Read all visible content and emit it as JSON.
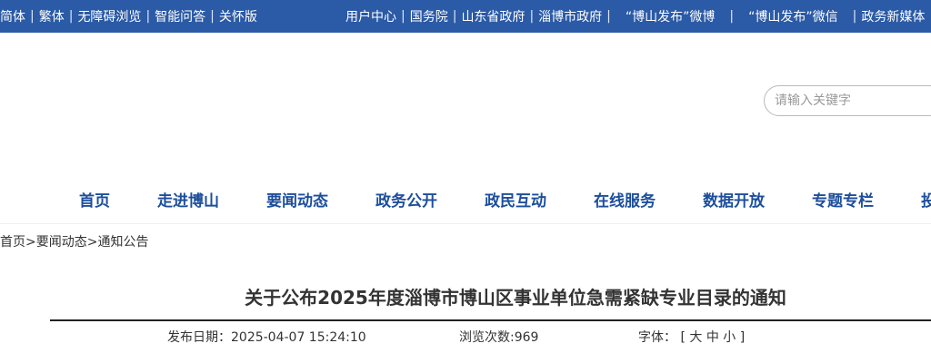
{
  "topbar": {
    "left": [
      "简体",
      "繁体",
      "无障碍浏览",
      "智能问答",
      "关怀版"
    ],
    "right": [
      "用户中心",
      "国务院",
      "山东省政府",
      "淄博市政府",
      "“博山发布”微博",
      "“博山发布”微信",
      "政务新媒体"
    ]
  },
  "search": {
    "placeholder": "请输入关键字"
  },
  "nav": [
    "首页",
    "走进博山",
    "要闻动态",
    "政务公开",
    "政民互动",
    "在线服务",
    "数据开放",
    "专题专栏",
    "投"
  ],
  "breadcrumb": {
    "items": [
      "首页",
      "要闻动态",
      "通知公告"
    ],
    "sep": ">"
  },
  "article": {
    "title": "关于公布2025年度淄博市博山区事业单位急需紧缺专业目录的通知",
    "date_label": "发布日期：",
    "date": "2025-04-07 15:24:10",
    "views_label": "浏览次数:",
    "views": "969",
    "font_label": "字体：",
    "bracket_open": "[",
    "font_large": "大",
    "font_medium": "中",
    "font_small": "小",
    "bracket_close": "]"
  },
  "colors": {
    "topbar": "#2b5aa6",
    "nav_text": "#1c4e9c"
  }
}
